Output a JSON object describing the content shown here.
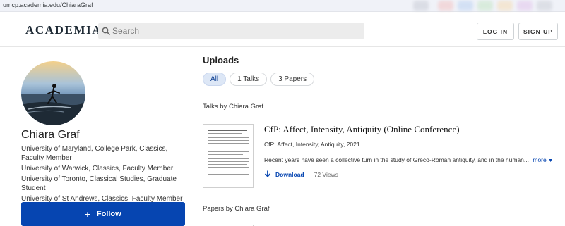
{
  "browser": {
    "url": "umcp.academia.edu/ChiaraGraf"
  },
  "header": {
    "logo": "ACADEMIA",
    "search_placeholder": "Search",
    "login_label": "LOG IN",
    "signup_label": "SIGN UP"
  },
  "profile": {
    "name": "Chiara Graf",
    "affiliations": [
      "University of Maryland, College Park, Classics, Faculty Member",
      "University of Warwick, Classics, Faculty Member",
      "University of Toronto, Classical Studies, Graduate Student",
      "University of St Andrews, Classics, Faculty Member"
    ],
    "follow_label": "Follow"
  },
  "uploads": {
    "title": "Uploads",
    "filters": [
      {
        "label": "All",
        "active": true
      },
      {
        "label": "1 Talks",
        "active": false
      },
      {
        "label": "3 Papers",
        "active": false
      }
    ],
    "talks_heading": "Talks by Chiara Graf",
    "papers_heading": "Papers by Chiara Graf",
    "talk": {
      "title": "CfP: Affect, Intensity, Antiquity (Online Conference)",
      "meta": "CfP: Affect, Intensity, Antiquity, 2021",
      "abstract": "Recent years have seen a collective turn in the study of Greco-Roman antiquity, and in the human...",
      "more_label": "more",
      "download_label": "Download",
      "views": "72 Views"
    }
  },
  "colors": {
    "brand_blue": "#0645b1",
    "active_pill_bg": "#dde7f6",
    "search_bg": "#ececec"
  }
}
